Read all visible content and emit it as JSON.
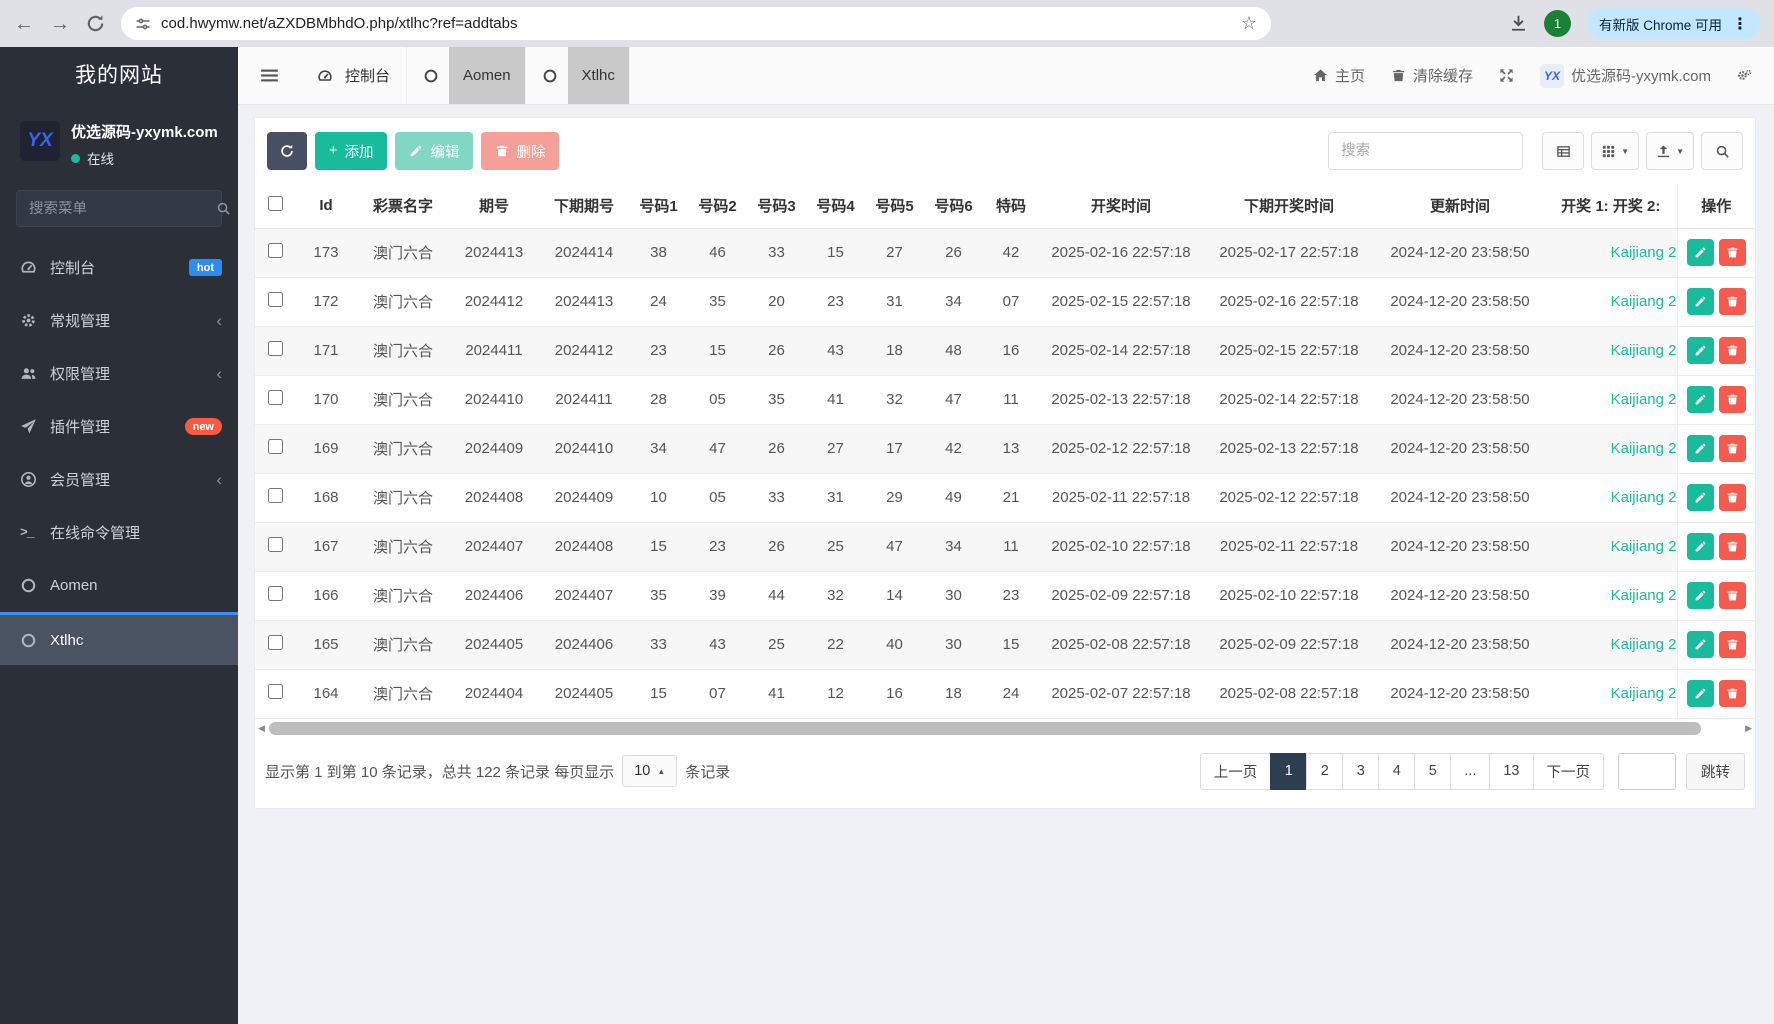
{
  "browser": {
    "url": "cod.hwymw.net/aZXDBMbhdO.php/xtlhc?ref=addtabs",
    "avatar_label": "1",
    "update_chip": "有新版 Chrome 可用",
    "icons": [
      "back-icon",
      "forward-icon",
      "refresh-icon",
      "tune-icon",
      "star-icon",
      "download-icon",
      "menu-dots-icon"
    ]
  },
  "sidebar": {
    "site_title": "我的网站",
    "user": {
      "name": "优选源码-yxymk.com",
      "status": "在线",
      "logo_text": "YX"
    },
    "search_placeholder": "搜索菜单",
    "search_icon": "search-icon",
    "items": [
      {
        "label": "控制台",
        "icon": "dashboard-icon",
        "badge": "hot",
        "badge_color": "#2d8cf0"
      },
      {
        "label": "常规管理",
        "icon": "gear-icon",
        "chevron": true
      },
      {
        "label": "权限管理",
        "icon": "users-icon",
        "chevron": true
      },
      {
        "label": "插件管理",
        "icon": "rocket-icon",
        "badge": "new",
        "badge_color": "#fa5a43"
      },
      {
        "label": "会员管理",
        "icon": "user-circle-icon",
        "chevron": true
      },
      {
        "label": "在线命令管理",
        "icon": "terminal-icon"
      },
      {
        "label": "Aomen",
        "icon": "circle-o-icon"
      },
      {
        "label": "Xtlhc",
        "icon": "circle-o-icon",
        "active": true
      }
    ]
  },
  "topbar": {
    "menu_icon": "hamburger-icon",
    "tabs": [
      {
        "label": "控制台",
        "icon": "dashboard-icon",
        "gray": false
      },
      {
        "label": "Aomen",
        "icon": "circle-o-icon",
        "gray": true
      },
      {
        "label": "Xtlhc",
        "icon": "circle-o-icon",
        "gray": true
      }
    ],
    "actions": [
      {
        "label": "主页",
        "icon": "home-icon"
      },
      {
        "label": "清除缓存",
        "icon": "trash-icon"
      },
      {
        "label": "",
        "icon": "expand-icon"
      },
      {
        "label": "优选源码-yxymk.com",
        "icon": "site-logo"
      },
      {
        "label": "",
        "icon": "cogs-icon"
      }
    ]
  },
  "toolbar": {
    "refresh_icon": "refresh-icon",
    "add_label": "添加",
    "edit_label": "编辑",
    "delete_label": "删除",
    "search_placeholder": "搜索",
    "view_icons": [
      "table-view-icon",
      "columns-icon",
      "export-icon",
      "search-icon"
    ]
  },
  "table": {
    "headers": [
      "Id",
      "彩票名字",
      "期号",
      "下期期号",
      "号码1",
      "号码2",
      "号码3",
      "号码4",
      "号码5",
      "号码6",
      "特码",
      "开奖时间",
      "下期开奖时间",
      "更新时间",
      "开奖 1: 开奖 2:",
      "操作"
    ],
    "action_icons": [
      "edit-pencil-icon",
      "delete-trash-icon"
    ],
    "rows": [
      {
        "id": "173",
        "name": "澳门六合",
        "issue": "2024413",
        "next_issue": "2024414",
        "nums": [
          "38",
          "46",
          "33",
          "15",
          "27",
          "26"
        ],
        "special": "42",
        "open_time": "2025-02-16 22:57:18",
        "next_open_time": "2025-02-17 22:57:18",
        "update_time": "2024-12-20 23:58:50",
        "link": "Kaijiang 2"
      },
      {
        "id": "172",
        "name": "澳门六合",
        "issue": "2024412",
        "next_issue": "2024413",
        "nums": [
          "24",
          "35",
          "20",
          "23",
          "31",
          "34"
        ],
        "special": "07",
        "open_time": "2025-02-15 22:57:18",
        "next_open_time": "2025-02-16 22:57:18",
        "update_time": "2024-12-20 23:58:50",
        "link": "Kaijiang 2"
      },
      {
        "id": "171",
        "name": "澳门六合",
        "issue": "2024411",
        "next_issue": "2024412",
        "nums": [
          "23",
          "15",
          "26",
          "43",
          "18",
          "48"
        ],
        "special": "16",
        "open_time": "2025-02-14 22:57:18",
        "next_open_time": "2025-02-15 22:57:18",
        "update_time": "2024-12-20 23:58:50",
        "link": "Kaijiang 2"
      },
      {
        "id": "170",
        "name": "澳门六合",
        "issue": "2024410",
        "next_issue": "2024411",
        "nums": [
          "28",
          "05",
          "35",
          "41",
          "32",
          "47"
        ],
        "special": "11",
        "open_time": "2025-02-13 22:57:18",
        "next_open_time": "2025-02-14 22:57:18",
        "update_time": "2024-12-20 23:58:50",
        "link": "Kaijiang 2"
      },
      {
        "id": "169",
        "name": "澳门六合",
        "issue": "2024409",
        "next_issue": "2024410",
        "nums": [
          "34",
          "47",
          "26",
          "27",
          "17",
          "42"
        ],
        "special": "13",
        "open_time": "2025-02-12 22:57:18",
        "next_open_time": "2025-02-13 22:57:18",
        "update_time": "2024-12-20 23:58:50",
        "link": "Kaijiang 2"
      },
      {
        "id": "168",
        "name": "澳门六合",
        "issue": "2024408",
        "next_issue": "2024409",
        "nums": [
          "10",
          "05",
          "33",
          "31",
          "29",
          "49"
        ],
        "special": "21",
        "open_time": "2025-02-11 22:57:18",
        "next_open_time": "2025-02-12 22:57:18",
        "update_time": "2024-12-20 23:58:50",
        "link": "Kaijiang 2"
      },
      {
        "id": "167",
        "name": "澳门六合",
        "issue": "2024407",
        "next_issue": "2024408",
        "nums": [
          "15",
          "23",
          "26",
          "25",
          "47",
          "34"
        ],
        "special": "11",
        "open_time": "2025-02-10 22:57:18",
        "next_open_time": "2025-02-11 22:57:18",
        "update_time": "2024-12-20 23:58:50",
        "link": "Kaijiang 2"
      },
      {
        "id": "166",
        "name": "澳门六合",
        "issue": "2024406",
        "next_issue": "2024407",
        "nums": [
          "35",
          "39",
          "44",
          "32",
          "14",
          "30"
        ],
        "special": "23",
        "open_time": "2025-02-09 22:57:18",
        "next_open_time": "2025-02-10 22:57:18",
        "update_time": "2024-12-20 23:58:50",
        "link": "Kaijiang 2"
      },
      {
        "id": "165",
        "name": "澳门六合",
        "issue": "2024405",
        "next_issue": "2024406",
        "nums": [
          "33",
          "43",
          "25",
          "22",
          "40",
          "30"
        ],
        "special": "15",
        "open_time": "2025-02-08 22:57:18",
        "next_open_time": "2025-02-09 22:57:18",
        "update_time": "2024-12-20 23:58:50",
        "link": "Kaijiang 2"
      },
      {
        "id": "164",
        "name": "澳门六合",
        "issue": "2024404",
        "next_issue": "2024405",
        "nums": [
          "15",
          "07",
          "41",
          "12",
          "16",
          "18"
        ],
        "special": "24",
        "open_time": "2025-02-07 22:57:18",
        "next_open_time": "2025-02-08 22:57:18",
        "update_time": "2024-12-20 23:58:50",
        "link": "Kaijiang 2"
      }
    ]
  },
  "pagination": {
    "summary_prefix": "显示第 1 到第 10 条记录，总共 122 条记录 每页显示",
    "page_size": "10",
    "summary_suffix": "条记录",
    "prev_label": "上一页",
    "pages": [
      "1",
      "2",
      "3",
      "4",
      "5",
      "...",
      "13"
    ],
    "active_page": "1",
    "next_label": "下一页",
    "jump_label": "跳转"
  },
  "colors": {
    "accent_green": "#18bc9c",
    "danger_red": "#e74c3c",
    "navy": "#2c3e50",
    "sidebar_bg": "#2a2f38",
    "hot_badge": "#2d8cf0",
    "new_badge": "#fa5a43",
    "chrome_chip": "#c2e7ff",
    "active_tab_gray": "#c9c9c9"
  }
}
